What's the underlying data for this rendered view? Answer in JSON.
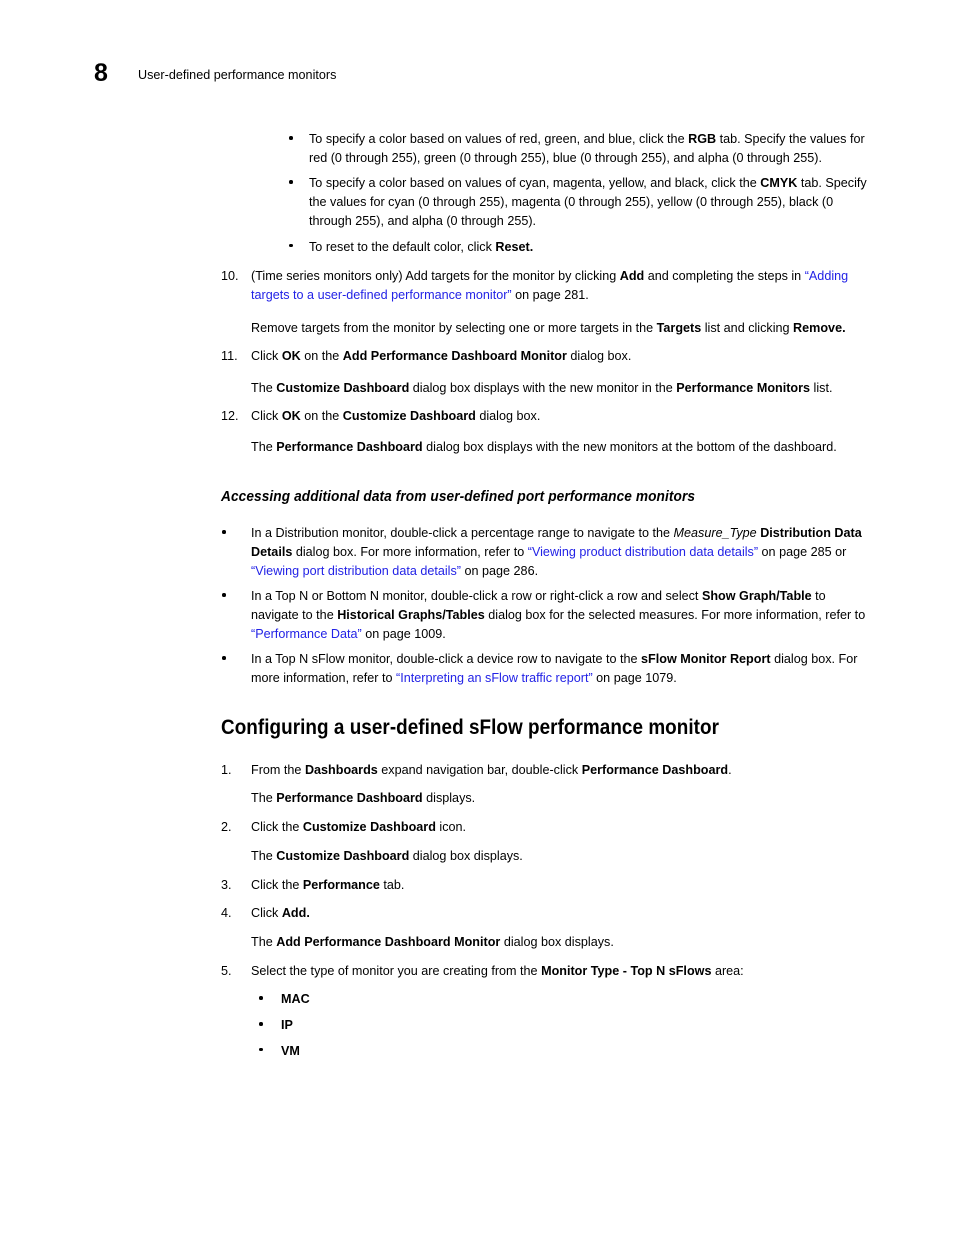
{
  "header": {
    "chapter_number": "8",
    "title": "User-defined performance monitors"
  },
  "color_bullets": [
    {
      "id": "rgb",
      "parts": [
        {
          "t": "To specify a color based on values of red, green, and blue, click the ",
          "s": "n"
        },
        {
          "t": "RGB",
          "s": "b"
        },
        {
          "t": " tab. Specify the values for red (0 through 255), green (0 through 255), blue (0 through 255), and alpha (0 through 255).",
          "s": "n"
        }
      ]
    },
    {
      "id": "cmyk",
      "parts": [
        {
          "t": "To specify a color based on values of cyan, magenta, yellow, and black, click the ",
          "s": "n"
        },
        {
          "t": "CMYK",
          "s": "b"
        },
        {
          "t": " tab. Specify the values for cyan (0 through 255), magenta (0 through 255), yellow (0 through 255), black (0 through 255), and alpha (0 through 255).",
          "s": "n"
        }
      ]
    },
    {
      "id": "reset",
      "parts": [
        {
          "t": "To reset to the default color, click ",
          "s": "n"
        },
        {
          "t": "Reset.",
          "s": "b"
        }
      ]
    }
  ],
  "steps_continued": {
    "step10": {
      "marker": "10.",
      "parts": [
        {
          "t": "(Time series monitors only) Add targets for the monitor by clicking ",
          "s": "n"
        },
        {
          "t": "Add",
          "s": "b"
        },
        {
          "t": " and completing the steps in ",
          "s": "n"
        },
        {
          "t": "“Adding targets to a user-defined performance monitor”",
          "s": "link"
        },
        {
          "t": " on page 281.",
          "s": "n"
        }
      ],
      "continuation": [
        {
          "t": "Remove targets from the monitor by selecting one or more targets in the ",
          "s": "n"
        },
        {
          "t": "Targets",
          "s": "b"
        },
        {
          "t": " list and clicking ",
          "s": "n"
        },
        {
          "t": "Remove.",
          "s": "b"
        }
      ]
    },
    "step11": {
      "marker": "11.",
      "parts": [
        {
          "t": "Click ",
          "s": "n"
        },
        {
          "t": "OK",
          "s": "b"
        },
        {
          "t": " on the ",
          "s": "n"
        },
        {
          "t": "Add Performance Dashboard Monitor",
          "s": "b"
        },
        {
          "t": " dialog box.",
          "s": "n"
        }
      ],
      "continuation": [
        {
          "t": "The ",
          "s": "n"
        },
        {
          "t": "Customize Dashboard",
          "s": "b"
        },
        {
          "t": " dialog box displays with the new monitor in the ",
          "s": "n"
        },
        {
          "t": "Performance Monitors",
          "s": "b"
        },
        {
          "t": " list.",
          "s": "n"
        }
      ]
    },
    "step12": {
      "marker": "12.",
      "parts": [
        {
          "t": "Click ",
          "s": "n"
        },
        {
          "t": "OK",
          "s": "b"
        },
        {
          "t": " on the ",
          "s": "n"
        },
        {
          "t": "Customize Dashboard",
          "s": "b"
        },
        {
          "t": " dialog box.",
          "s": "n"
        }
      ],
      "continuation": [
        {
          "t": "The ",
          "s": "n"
        },
        {
          "t": "Performance Dashboard",
          "s": "b"
        },
        {
          "t": " dialog box displays with the new monitors at the bottom of the dashboard.",
          "s": "n"
        }
      ]
    }
  },
  "section_heading": "Accessing additional data from user-defined port performance monitors",
  "access_bullets": [
    {
      "id": "distribution",
      "parts": [
        {
          "t": "In a Distribution monitor, double-click a percentage range to navigate to the ",
          "s": "n"
        },
        {
          "t": "Measure_Type",
          "s": "i"
        },
        {
          "t": " ",
          "s": "n"
        },
        {
          "t": "Distribution Data Details",
          "s": "b"
        },
        {
          "t": " dialog box. For more information, refer to ",
          "s": "n"
        },
        {
          "t": "“Viewing product distribution data details”",
          "s": "link"
        },
        {
          "t": " on page 285 or ",
          "s": "n"
        },
        {
          "t": "“Viewing port distribution data details”",
          "s": "link"
        },
        {
          "t": " on page 286.",
          "s": "n"
        }
      ]
    },
    {
      "id": "topn-bottomn",
      "parts": [
        {
          "t": "In a Top N or Bottom N monitor, double-click a row or right-click a row and select ",
          "s": "n"
        },
        {
          "t": "Show Graph/Table",
          "s": "b"
        },
        {
          "t": " to navigate to the ",
          "s": "n"
        },
        {
          "t": "Historical Graphs/Tables",
          "s": "b"
        },
        {
          "t": " dialog box for the selected measures. For more information, refer to ",
          "s": "n"
        },
        {
          "t": "“Performance Data”",
          "s": "link"
        },
        {
          "t": " on page 1009.",
          "s": "n"
        }
      ]
    },
    {
      "id": "topn-sflow",
      "parts": [
        {
          "t": "In a Top N sFlow monitor, double-click a device row to navigate to the ",
          "s": "n"
        },
        {
          "t": "sFlow Monitor Report",
          "s": "b"
        },
        {
          "t": " dialog box. For more information, refer to ",
          "s": "n"
        },
        {
          "t": "“Interpreting an sFlow traffic report”",
          "s": "link"
        },
        {
          "t": " on page 1079.",
          "s": "n"
        }
      ]
    }
  ],
  "main_heading": "Configuring a user-defined sFlow performance monitor",
  "sflow_steps": {
    "step1": {
      "marker": "1.",
      "parts": [
        {
          "t": "From the ",
          "s": "n"
        },
        {
          "t": "Dashboards",
          "s": "b"
        },
        {
          "t": " expand navigation bar, double-click ",
          "s": "n"
        },
        {
          "t": "Performance Dashboard",
          "s": "b"
        },
        {
          "t": ".",
          "s": "n"
        }
      ],
      "continuation": [
        {
          "t": "The ",
          "s": "n"
        },
        {
          "t": "Performance Dashboard",
          "s": "b"
        },
        {
          "t": " displays.",
          "s": "n"
        }
      ]
    },
    "step2": {
      "marker": "2.",
      "parts": [
        {
          "t": "Click the ",
          "s": "n"
        },
        {
          "t": "Customize Dashboard",
          "s": "b"
        },
        {
          "t": " icon.",
          "s": "n"
        }
      ],
      "continuation": [
        {
          "t": "The ",
          "s": "n"
        },
        {
          "t": "Customize Dashboard",
          "s": "b"
        },
        {
          "t": " dialog box displays.",
          "s": "n"
        }
      ]
    },
    "step3": {
      "marker": "3.",
      "parts": [
        {
          "t": "Click the ",
          "s": "n"
        },
        {
          "t": "Performance",
          "s": "b"
        },
        {
          "t": " tab.",
          "s": "n"
        }
      ]
    },
    "step4": {
      "marker": "4.",
      "parts": [
        {
          "t": "Click ",
          "s": "n"
        },
        {
          "t": "Add.",
          "s": "b"
        }
      ],
      "continuation": [
        {
          "t": "The ",
          "s": "n"
        },
        {
          "t": "Add Performance Dashboard Monitor",
          "s": "b"
        },
        {
          "t": " dialog box displays.",
          "s": "n"
        }
      ]
    },
    "step5": {
      "marker": "5.",
      "parts": [
        {
          "t": "Select the type of monitor you are creating from the ",
          "s": "n"
        },
        {
          "t": "Monitor Type - Top N sFlows",
          "s": "b"
        },
        {
          "t": " area:",
          "s": "n"
        }
      ],
      "options": [
        {
          "label": "MAC"
        },
        {
          "label": "IP"
        },
        {
          "label": "VM"
        }
      ]
    }
  },
  "colors": {
    "link": "#2222e6",
    "text": "#000000",
    "background": "#ffffff"
  }
}
